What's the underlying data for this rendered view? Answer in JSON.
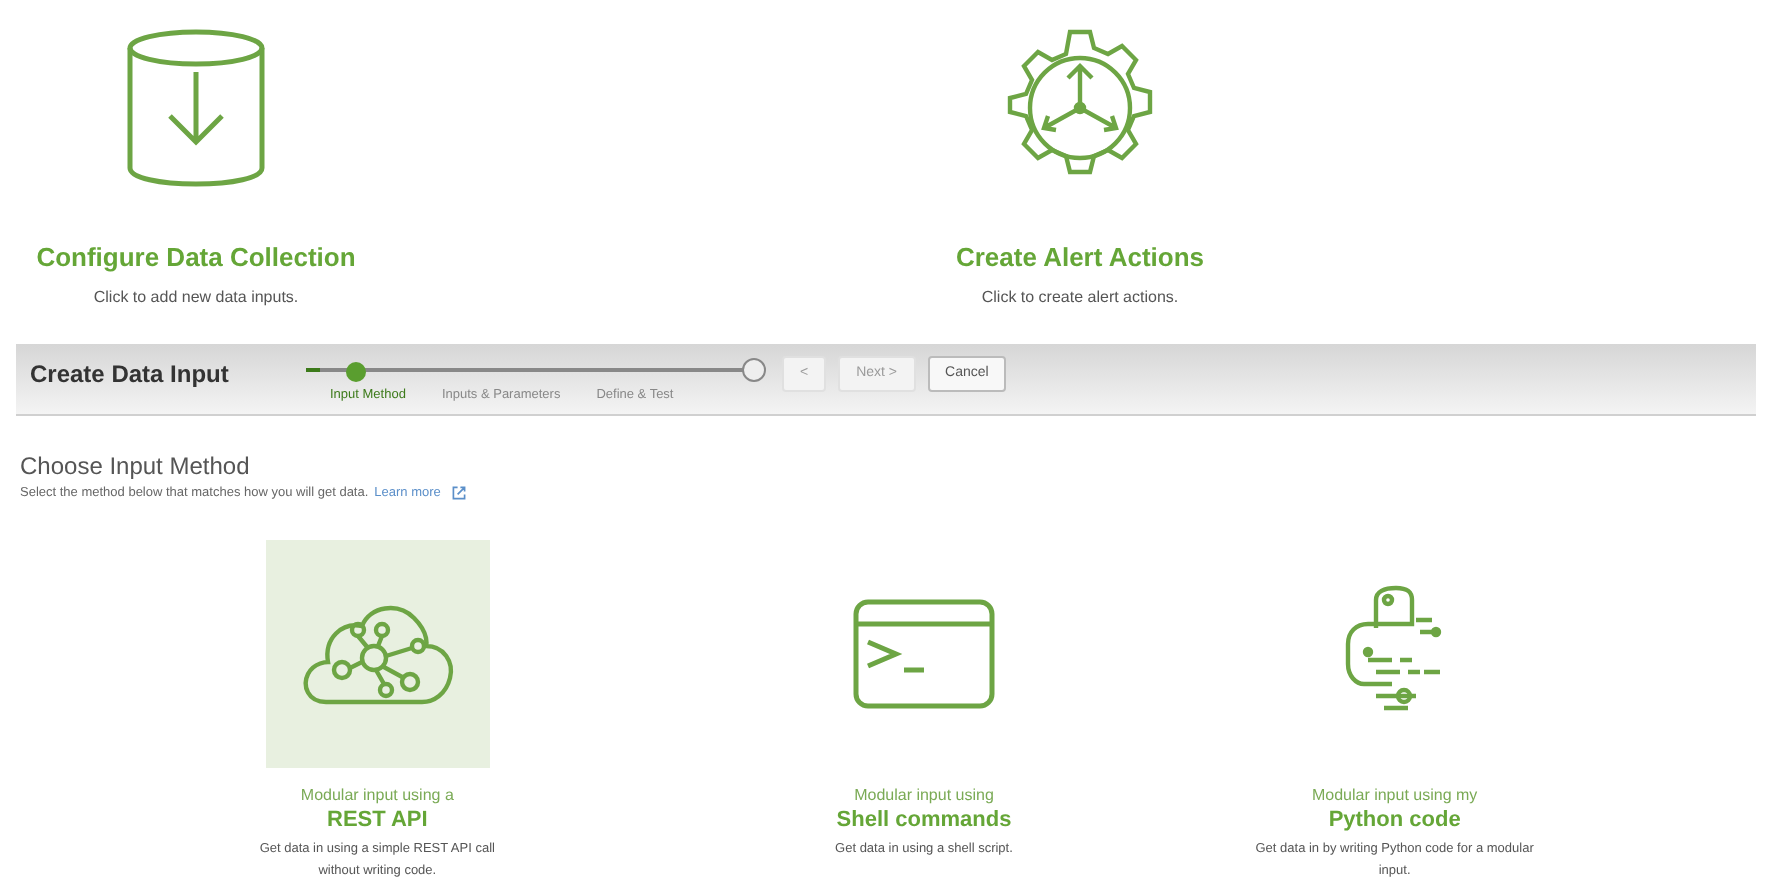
{
  "actions": [
    {
      "kind": "collection",
      "title": "Configure Data Collection",
      "subtitle": "Click to add new data inputs."
    },
    {
      "kind": "alert",
      "title": "Create Alert Actions",
      "subtitle": "Click to create alert actions."
    }
  ],
  "wizard": {
    "title": "Create Data Input",
    "level": 0.03,
    "steps": [
      {
        "label": "Input Method",
        "selected": true
      },
      {
        "label": "Inputs & Parameters",
        "selected": false
      },
      {
        "label": "Define & Test",
        "selected": false
      }
    ],
    "buttons": [
      {
        "label": "<",
        "disabled": true
      },
      {
        "label": "Next >",
        "disabled": true
      },
      {
        "label": "Cancel",
        "disabled": false
      }
    ]
  },
  "section": {
    "title": "Choose Input Method",
    "description": "Select the method below that matches how you will get data.",
    "link": "Learn more"
  },
  "methods": [
    {
      "kind": "rest",
      "selected": true,
      "line_1": "Modular input using a",
      "line_2": "REST API",
      "description": "Get data in using a simple REST API call without writing code."
    },
    {
      "kind": "shell",
      "selected": false,
      "line_1": "Modular input using",
      "line_2": "Shell commands",
      "description": "Get data in using a shell script."
    },
    {
      "kind": "python",
      "selected": false,
      "line_1": "Modular input using my",
      "line_2": "Python code",
      "description": "Get data in by writing Python code for a modular input."
    }
  ]
}
